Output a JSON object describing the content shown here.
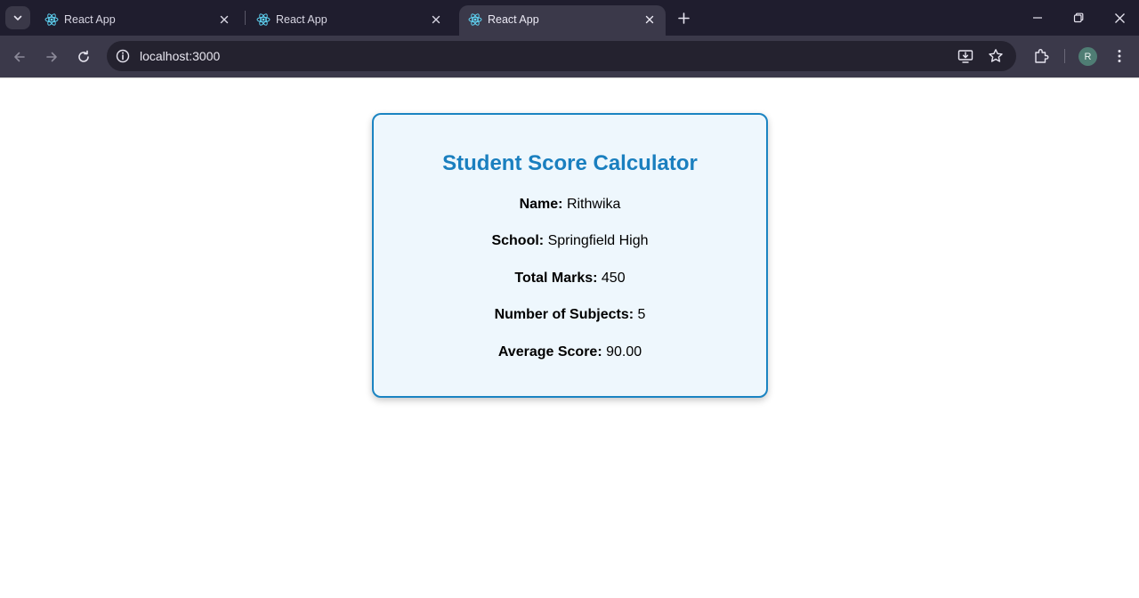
{
  "browser": {
    "tabs": [
      {
        "title": "React App",
        "active": false
      },
      {
        "title": "React App",
        "active": false
      },
      {
        "title": "React App",
        "active": true
      }
    ],
    "url": "localhost:3000",
    "profile_initial": "R"
  },
  "colors": {
    "accent": "#1a7fbf",
    "card_background": "#eef7fd",
    "card_border": "#1b84c2"
  },
  "card": {
    "title": "Student Score Calculator",
    "fields": [
      {
        "label": "Name:",
        "value": "Rithwika"
      },
      {
        "label": "School:",
        "value": "Springfield High"
      },
      {
        "label": "Total Marks:",
        "value": "450"
      },
      {
        "label": "Number of Subjects:",
        "value": "5"
      },
      {
        "label": "Average Score:",
        "value": "90.00"
      }
    ]
  }
}
